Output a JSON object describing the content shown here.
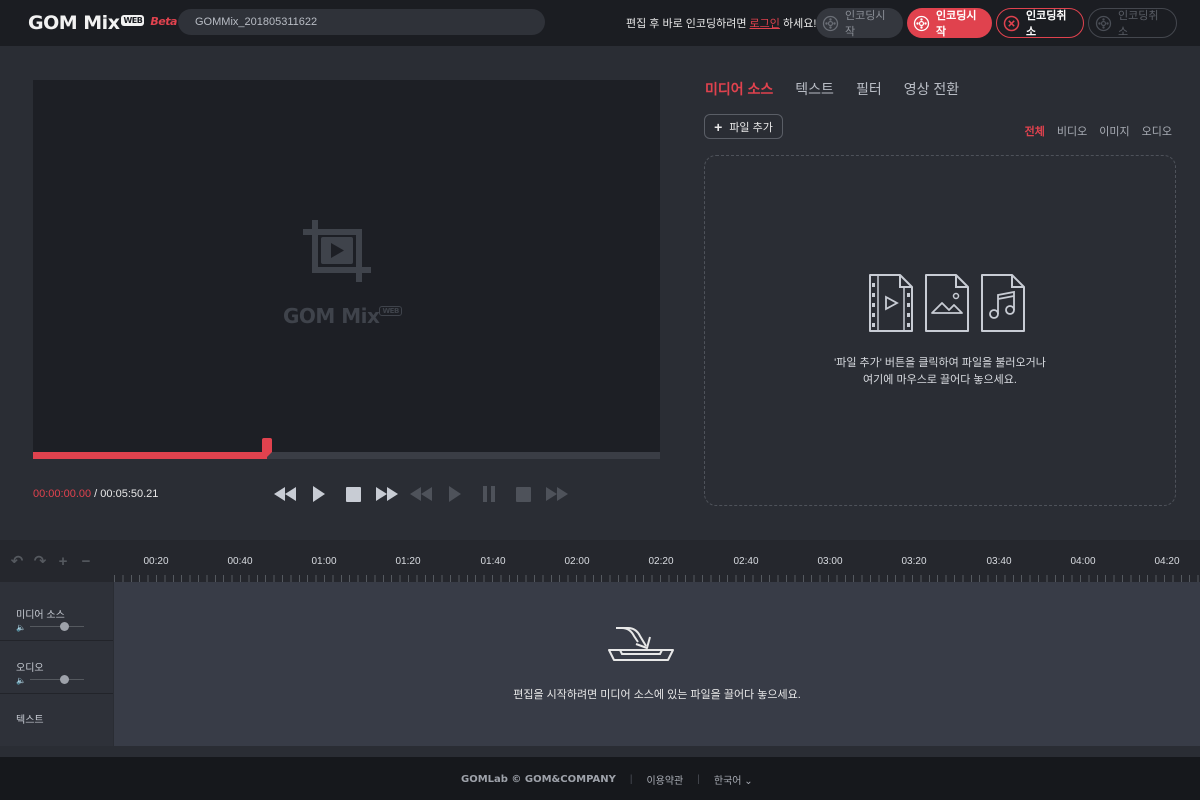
{
  "app": {
    "logo": "GOM Mix",
    "logo_badge": "WEB",
    "beta": "Beta"
  },
  "project": {
    "name": "GOMMix_201805311622"
  },
  "notice": {
    "before": "편집 후 바로 인코딩하려면 ",
    "login": "로그인",
    "after": " 하세요!"
  },
  "encode": [
    {
      "label": "인코딩시작",
      "state": "disabled"
    },
    {
      "label": "인코딩시작",
      "state": "primary"
    },
    {
      "label": "인코딩취소",
      "state": "outline"
    },
    {
      "label": "인코딩취소",
      "state": "disabled"
    }
  ],
  "preview": {
    "watermark": "GOM Mix",
    "watermark_badge": "WEB",
    "current_time": "00:00:00.00",
    "separator": " / ",
    "total_time": "00:05:50.21",
    "progress_percent": 37.3
  },
  "media_panel": {
    "tabs": [
      "미디어 소스",
      "텍스트",
      "필터",
      "영상 전환"
    ],
    "active_tab": 0,
    "add_file": "파일 추가",
    "filters": [
      "전체",
      "비디오",
      "이미지",
      "오디오"
    ],
    "active_filter": 0,
    "drop_line1": "'파일 추가' 버튼을 클릭하여 파일을 불러오거나",
    "drop_line2": "여기에 마우스로 끌어다 놓으세요."
  },
  "timeline": {
    "ruler": [
      "00:20",
      "00:40",
      "01:00",
      "01:20",
      "01:40",
      "02:00",
      "02:20",
      "02:40",
      "03:00",
      "03:20",
      "03:40",
      "04:00",
      "04:20"
    ],
    "tracks": [
      "미디어 소스",
      "오디오",
      "텍스트"
    ],
    "empty_message": "편집을 시작하려면 미디어 소스에 있는 파일을 끌어다 놓으세요."
  },
  "footer": {
    "brand": "GOMLab © GOM&COMPANY",
    "terms": "이용약관",
    "language": "한국어"
  },
  "colors": {
    "accent": "#e0424e",
    "bg": "#2a2d34",
    "topbar": "#1b1d22",
    "preview": "#1d1f25",
    "timeline": "#383c47"
  }
}
